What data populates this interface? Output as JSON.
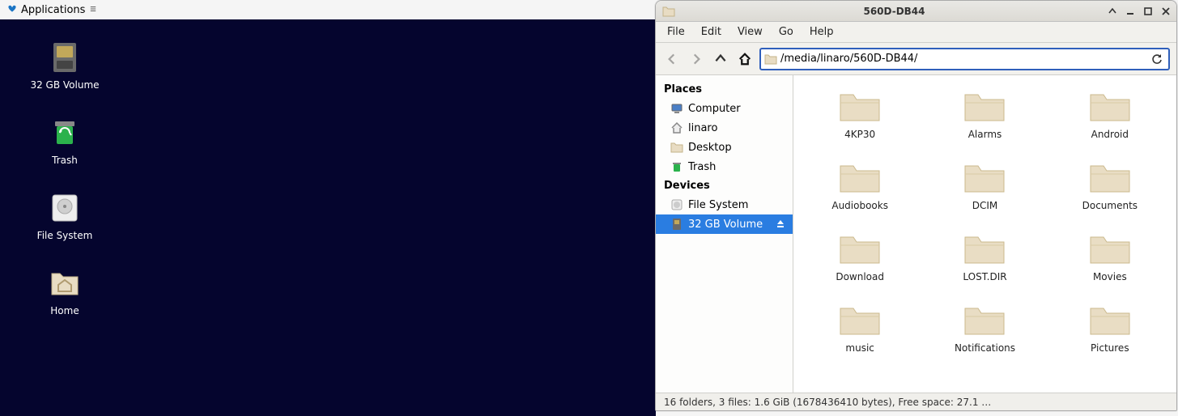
{
  "panel": {
    "applications_label": "Applications"
  },
  "desktop": {
    "icons": [
      {
        "label": "32 GB Volume"
      },
      {
        "label": "Trash"
      },
      {
        "label": "File System"
      },
      {
        "label": "Home"
      }
    ]
  },
  "fm": {
    "title": "560D-DB44",
    "menubar": [
      "File",
      "Edit",
      "View",
      "Go",
      "Help"
    ],
    "location": "/media/linaro/560D-DB44/",
    "sidebar": {
      "places_header": "Places",
      "places": [
        {
          "label": "Computer"
        },
        {
          "label": "linaro"
        },
        {
          "label": "Desktop"
        },
        {
          "label": "Trash"
        }
      ],
      "devices_header": "Devices",
      "devices": [
        {
          "label": "File System"
        },
        {
          "label": "32 GB Volume",
          "selected": true,
          "ejectable": true
        }
      ]
    },
    "folders": [
      "4KP30",
      "Alarms",
      "Android",
      "Audiobooks",
      "DCIM",
      "Documents",
      "Download",
      "LOST.DIR",
      "Movies",
      "music",
      "Notifications",
      "Pictures"
    ],
    "statusbar": "16 folders, 3 files: 1.6 GiB (1678436410 bytes), Free space: 27.1 …"
  }
}
